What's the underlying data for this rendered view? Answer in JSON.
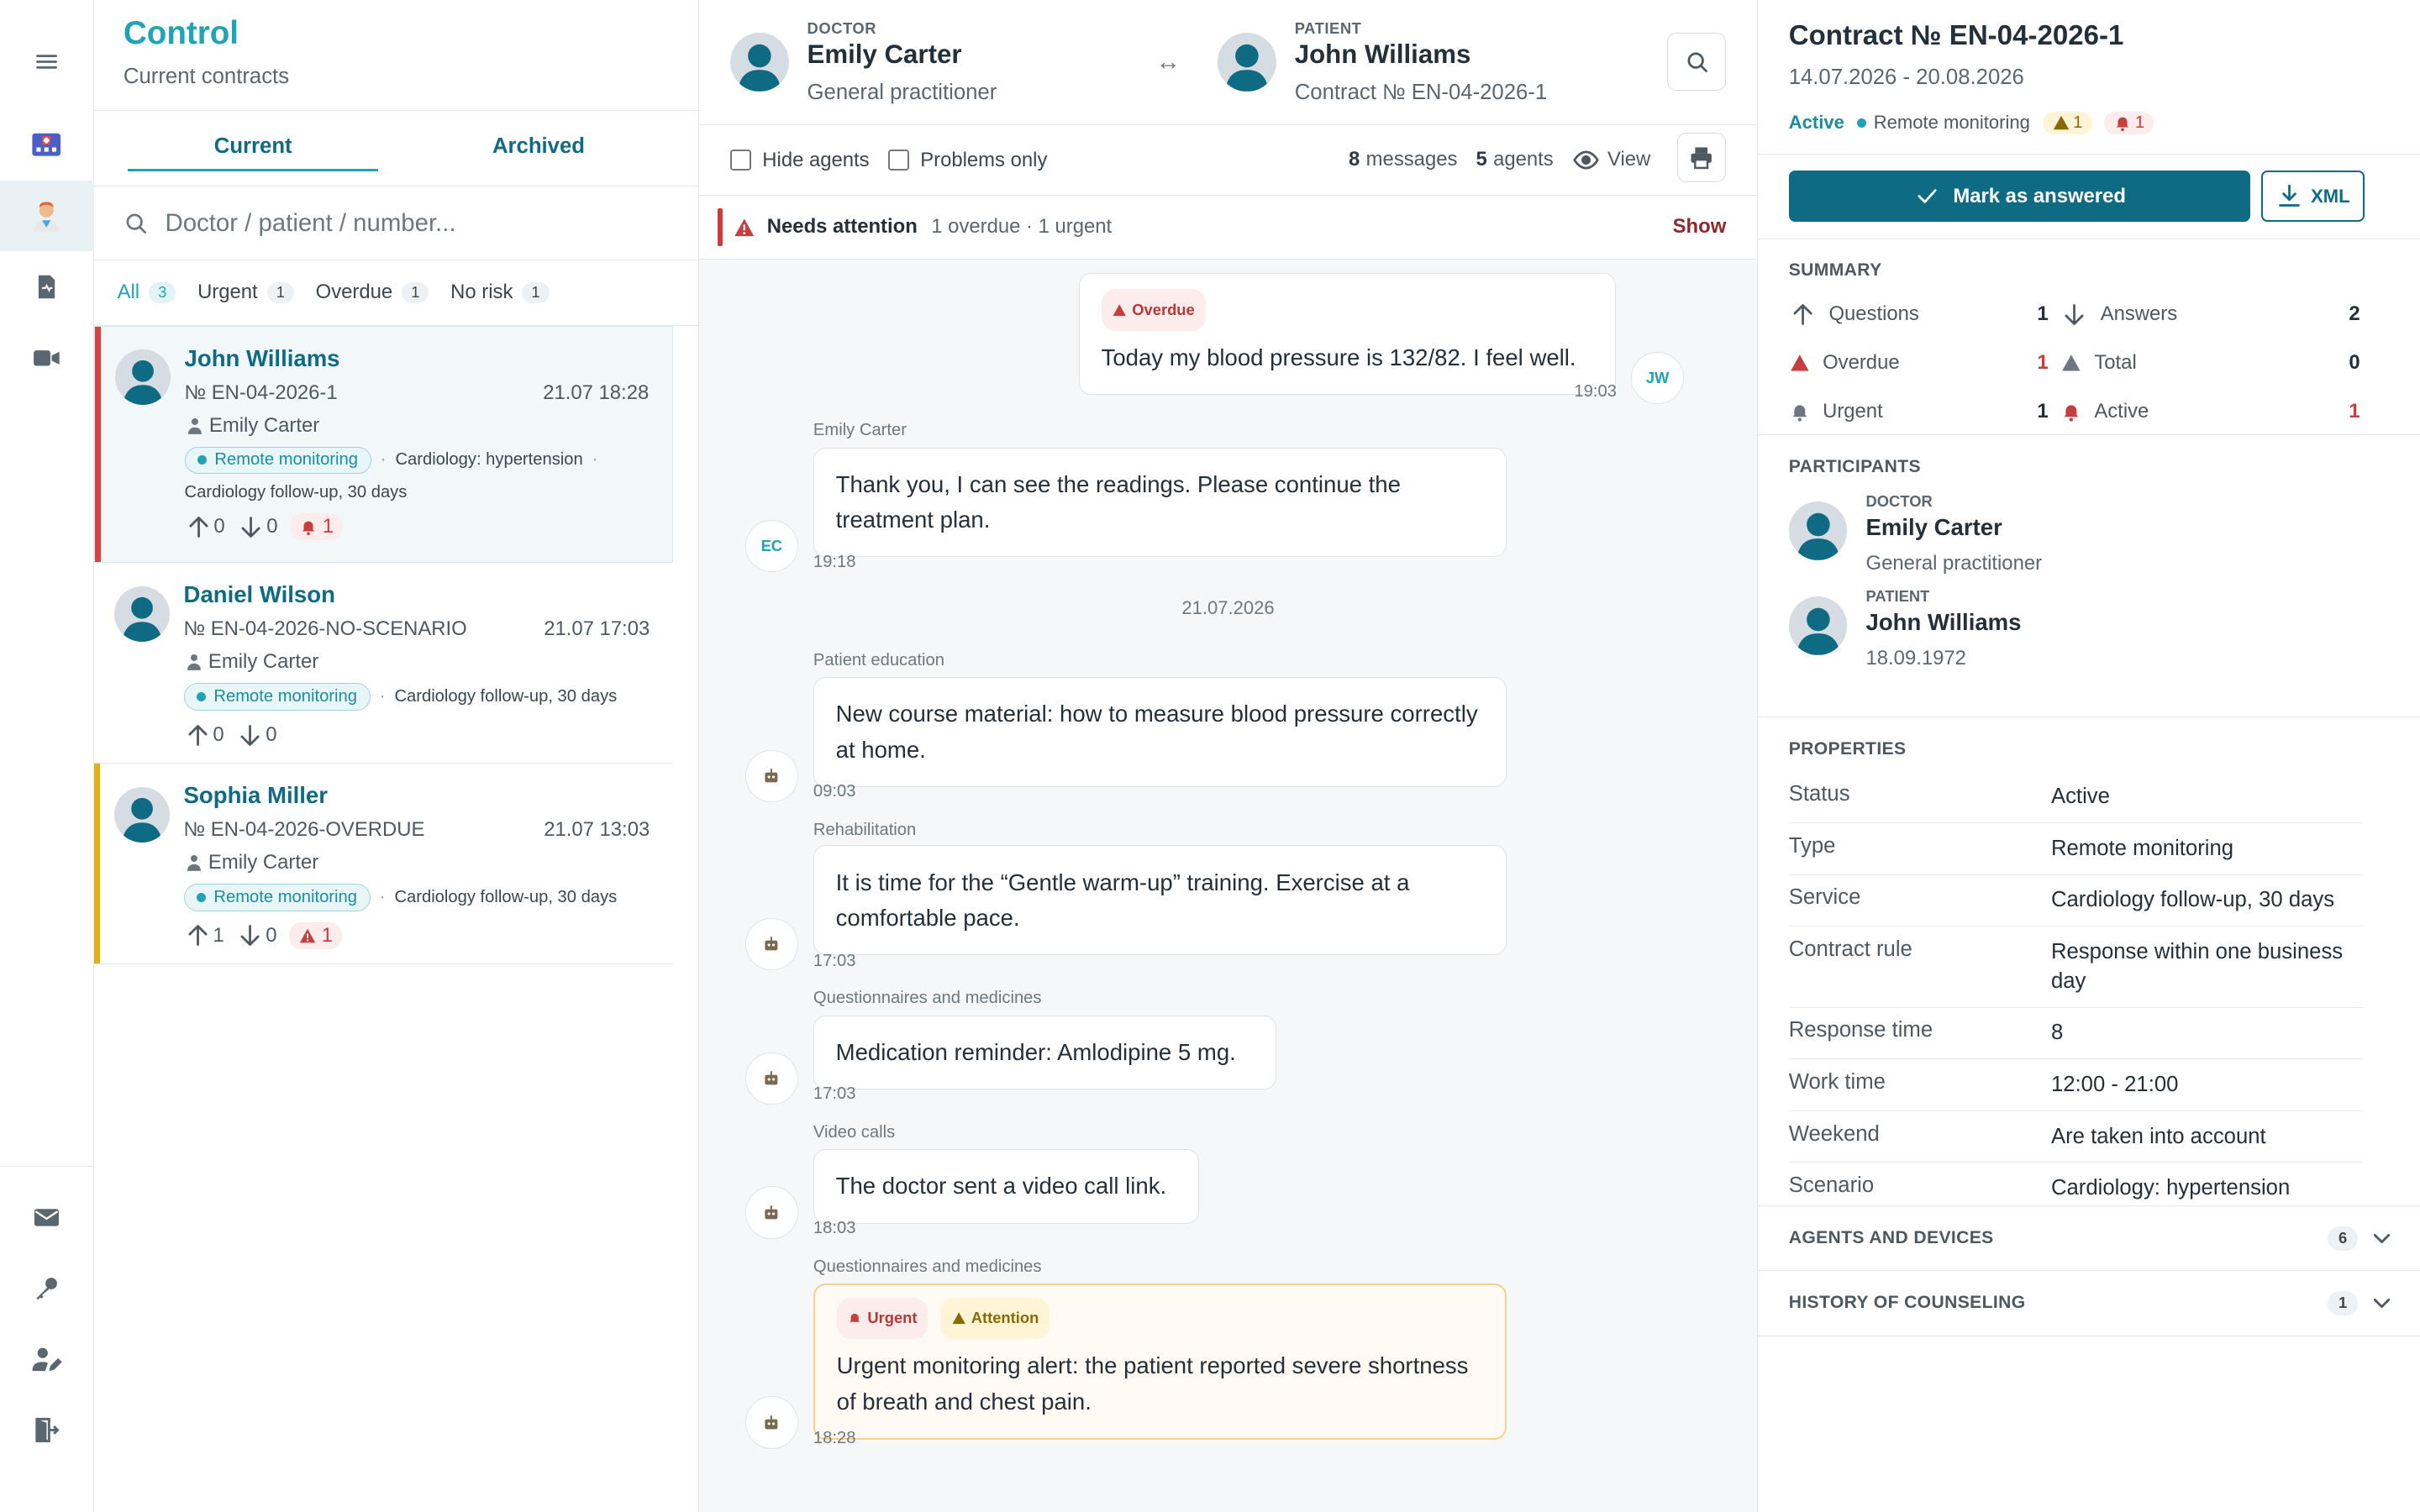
{
  "app": {
    "title": "Control",
    "subtitle": "Current contracts"
  },
  "tabs": [
    {
      "label": "Current"
    },
    {
      "label": "Archived"
    }
  ],
  "search": {
    "placeholder": "Doctor / patient / number..."
  },
  "filters": [
    {
      "label": "All",
      "count": "3"
    },
    {
      "label": "Urgent",
      "count": "1"
    },
    {
      "label": "Overdue",
      "count": "1"
    },
    {
      "label": "No risk",
      "count": "1"
    }
  ],
  "contracts": [
    {
      "name": "John Williams",
      "number": "№ EN-04-2026-1",
      "time": "21.07 18:28",
      "doctor": "Emily Carter",
      "tag": "Remote monitoring",
      "scenario": "Cardiology: hypertension",
      "service": "Cardiology follow-up, 30 days",
      "up": "0",
      "down": "0",
      "alerts": "1",
      "stripe": "#d64545"
    },
    {
      "name": "Daniel Wilson",
      "number": "№ EN-04-2026-NO-SCENARIO",
      "time": "21.07 17:03",
      "doctor": "Emily Carter",
      "tag": "Remote monitoring",
      "service": "Cardiology follow-up, 30 days",
      "up": "0",
      "down": "0"
    },
    {
      "name": "Sophia Miller",
      "number": "№ EN-04-2026-OVERDUE",
      "time": "21.07 13:03",
      "doctor": "Emily Carter",
      "tag": "Remote monitoring",
      "service": "Cardiology follow-up, 30 days",
      "up": "1",
      "down": "0",
      "alerts": "1",
      "stripe": "#e2b014"
    }
  ],
  "chat_header": {
    "doctor": {
      "label": "DOCTOR",
      "name": "Emily Carter",
      "sub": "General practitioner"
    },
    "patient": {
      "label": "PATIENT",
      "name": "John Williams",
      "sub": "Contract № EN-04-2026-1"
    },
    "swap": "↔"
  },
  "toolbar": {
    "hide_agents": "Hide agents",
    "problems_only": "Problems only",
    "messages_count": "8",
    "messages_label": "messages",
    "agents_count": "5",
    "agents_label": "agents",
    "view_label": "View"
  },
  "attention": {
    "title": "Needs attention",
    "details": "1 overdue · 1 urgent",
    "action": "Show"
  },
  "messages": [
    {
      "sender": "John Williams",
      "badge": "Overdue",
      "text": "Today my blood pressure is 132/82. I feel well.",
      "time": "19:03",
      "avatar": "JW"
    },
    {
      "sender": "Emily Carter",
      "text": "Thank you, I can see the readings. Please continue the treatment plan.",
      "time": "19:18",
      "avatar": "EC"
    },
    {
      "date": "21.07.2026"
    },
    {
      "sender": "Patient education",
      "text": "New course material: how to measure blood pressure correctly at home.",
      "time": "09:03"
    },
    {
      "sender": "Rehabilitation",
      "text": "It is time for the “Gentle warm-up” training. Exercise at a comfortable pace.",
      "time": "17:03"
    },
    {
      "sender": "Questionnaires and medicines",
      "text": "Medication reminder: Amlodipine 5 mg.",
      "time": "17:03"
    },
    {
      "sender": "Video calls",
      "text": "The doctor sent a video call link.",
      "time": "18:03"
    },
    {
      "sender": "Questionnaires and medicines",
      "badge1": "Urgent",
      "badge2": "Attention",
      "text": "Urgent monitoring alert: the patient reported severe shortness of breath and chest pain.",
      "time": "18:28"
    }
  ],
  "details": {
    "title": "Contract № EN-04-2026-1",
    "dates": "14.07.2026 - 20.08.2026",
    "status": "Active",
    "type": "Remote monitoring",
    "warn_count": "1",
    "alert_count": "1",
    "mark_answered": "Mark as answered",
    "xml": "XML"
  },
  "summary": {
    "title": "SUMMARY",
    "rows": [
      {
        "label": "Questions",
        "value": "1"
      },
      {
        "label": "Answers",
        "value": "2"
      },
      {
        "label": "Overdue",
        "value": "1"
      },
      {
        "label": "Total",
        "value": "0"
      },
      {
        "label": "Urgent",
        "value": "1"
      },
      {
        "label": "Active",
        "value": "1"
      }
    ]
  },
  "participants": {
    "title": "PARTICIPANTS",
    "doctor": {
      "label": "DOCTOR",
      "name": "Emily Carter",
      "sub": "General practitioner"
    },
    "patient": {
      "label": "PATIENT",
      "name": "John Williams",
      "sub": "18.09.1972"
    }
  },
  "properties": {
    "title": "PROPERTIES",
    "rows": [
      {
        "key": "Status",
        "value": "Active"
      },
      {
        "key": "Type",
        "value": "Remote monitoring"
      },
      {
        "key": "Service",
        "value": "Cardiology follow-up, 30 days"
      },
      {
        "key": "Contract rule",
        "value": "Response within one business day"
      },
      {
        "key": "Response time",
        "value": "8"
      },
      {
        "key": "Work time",
        "value": "12:00 - 21:00"
      },
      {
        "key": "Weekend",
        "value": "Are taken into account"
      },
      {
        "key": "Scenario",
        "value": "Cardiology: hypertension"
      }
    ]
  },
  "agents_section": {
    "title": "AGENTS AND DEVICES",
    "count": "6"
  },
  "history_section": {
    "title": "HISTORY OF COUNSELING",
    "count": "1"
  },
  "colors": {
    "accent": "#1fa3b5",
    "primary": "#0e6b83",
    "danger": "#c83d3d",
    "warning": "#e2b014"
  }
}
